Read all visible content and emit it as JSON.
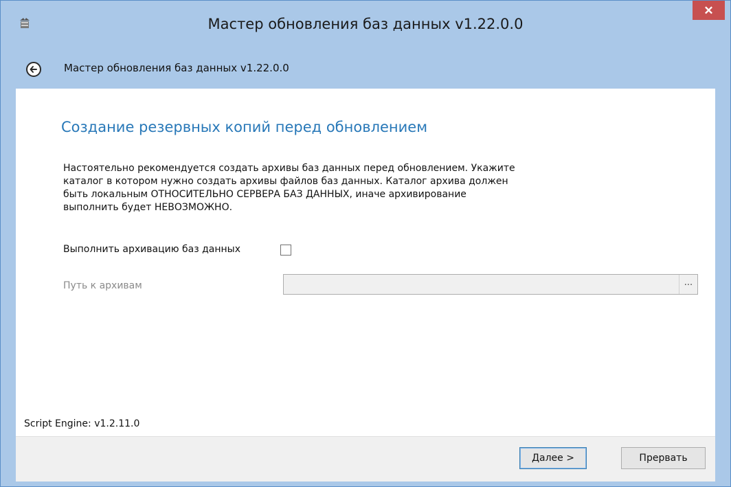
{
  "window": {
    "title": "Мастер обновления баз данных v1.22.0.0",
    "close_label": "✕",
    "app_icon": "app-icon"
  },
  "navbar": {
    "back_icon": "back-arrow-icon",
    "title": "Мастер обновления баз данных v1.22.0.0"
  },
  "page": {
    "heading": "Создание резервных копий перед обновлением",
    "description_lines": [
      "Настоятельно рекомендуется создать архивы баз данных перед обновлением. Укажите",
      "каталог в котором нужно создать архивы файлов баз данных. Каталог архива должен",
      "быть локальным ОТНОСИТЕЛЬНО СЕРВЕРА БАЗ ДАННЫХ, иначе архивирование",
      "выполнить будет НЕВОЗМОЖНО."
    ],
    "archive_checkbox": {
      "label": "Выполнить архивацию баз данных",
      "checked": false
    },
    "path": {
      "label": "Путь к архивам",
      "value": "",
      "browse_label": "..."
    },
    "engine_version": "Script Engine: v1.2.11.0"
  },
  "footer": {
    "next_mnemonic": "Д",
    "next_rest": "алее >",
    "cancel_label": "Прервать"
  },
  "colors": {
    "chrome": "#aac8e8",
    "heading": "#2878b8",
    "close_button": "#c75050"
  }
}
